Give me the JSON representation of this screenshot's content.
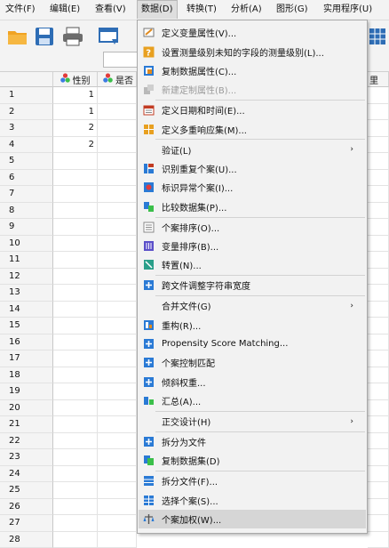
{
  "menubar": {
    "items": [
      {
        "label": "文件(F)"
      },
      {
        "label": "编辑(E)"
      },
      {
        "label": "查看(V)"
      },
      {
        "label": "数据(D)"
      },
      {
        "label": "转换(T)"
      },
      {
        "label": "分析(A)"
      },
      {
        "label": "图形(G)"
      },
      {
        "label": "实用程序(U)"
      }
    ],
    "active": "数据(D)"
  },
  "grid": {
    "columns": [
      {
        "label": "性别",
        "icon": "nominal-variable-icon"
      },
      {
        "label": "是否",
        "icon": "nominal-variable-icon"
      }
    ],
    "partial_right_header": "里",
    "rows": [
      "1",
      "2",
      "3",
      "4",
      "5",
      "6",
      "7",
      "8",
      "9",
      "10",
      "11",
      "12",
      "13",
      "14",
      "15",
      "16",
      "17",
      "18",
      "19",
      "20",
      "21",
      "22",
      "23",
      "24",
      "25",
      "26",
      "27",
      "28"
    ],
    "col1_values": [
      "1",
      "1",
      "2",
      "2"
    ]
  },
  "data_menu": {
    "items": [
      {
        "label": "定义变量属性(V)...",
        "icon": "define-variable-properties-icon"
      },
      {
        "label": "设置测量级别未知的字段的测量级别(L)...",
        "icon": "set-measurement-level-icon"
      },
      {
        "label": "复制数据属性(C)...",
        "icon": "copy-data-properties-icon"
      },
      {
        "label": "新建定制属性(B)...",
        "icon": "new-custom-attribute-icon",
        "disabled": true
      },
      {
        "label": "定义日期和时间(E)...",
        "icon": "define-dates-icon"
      },
      {
        "label": "定义多重响应集(M)...",
        "icon": "multiple-response-icon"
      },
      {
        "label": "验证(L)",
        "submenu": true
      },
      {
        "label": "识别重复个案(U)...",
        "icon": "duplicate-cases-icon"
      },
      {
        "label": "标识异常个案(I)...",
        "icon": "unusual-cases-icon"
      },
      {
        "label": "比较数据集(P)...",
        "icon": "compare-datasets-icon"
      },
      {
        "label": "个案排序(O)...",
        "icon": "sort-cases-icon"
      },
      {
        "label": "变量排序(B)...",
        "icon": "sort-variables-icon"
      },
      {
        "label": "转置(N)...",
        "icon": "transpose-icon"
      },
      {
        "label": "跨文件调整字符串宽度",
        "icon": "adjust-string-width-icon"
      },
      {
        "label": "合并文件(G)",
        "submenu": true
      },
      {
        "label": "重构(R)...",
        "icon": "restructure-icon"
      },
      {
        "label": "Propensity Score Matching...",
        "icon": "propensity-matching-icon"
      },
      {
        "label": "个案控制匹配",
        "icon": "case-control-matching-icon"
      },
      {
        "label": "倾斜权重...",
        "icon": "rake-weights-icon"
      },
      {
        "label": "汇总(A)...",
        "icon": "aggregate-icon"
      },
      {
        "label": "正交设计(H)",
        "submenu": true
      },
      {
        "label": "拆分为文件",
        "icon": "split-into-files-icon"
      },
      {
        "label": "复制数据集(D)",
        "icon": "copy-dataset-icon"
      },
      {
        "label": "拆分文件(F)...",
        "icon": "split-file-icon"
      },
      {
        "label": "选择个案(S)...",
        "icon": "select-cases-icon"
      },
      {
        "label": "个案加权(W)...",
        "icon": "weight-cases-icon",
        "hover": true
      }
    ],
    "submenu_arrow": "›"
  },
  "colors": {
    "menubar_bg": "#f3f3f3",
    "menu_bg": "#f2f2f2",
    "hover_bg": "#d6d6d6",
    "accent_blue": "#2a7ad5"
  }
}
